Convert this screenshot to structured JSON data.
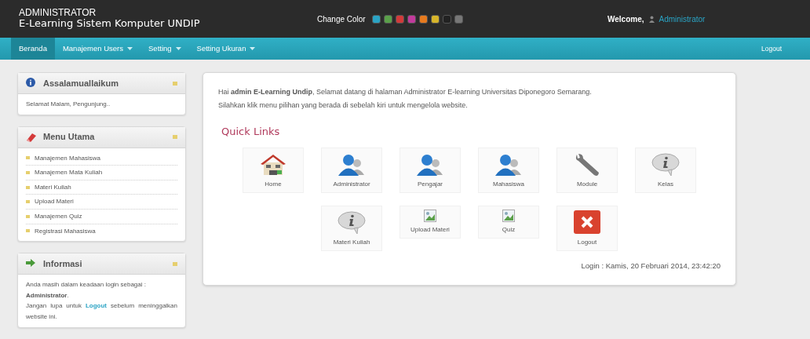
{
  "header": {
    "role": "ADMINISTRATOR",
    "site_title": "E-Learning Sistem Komputer UNDIP",
    "change_color_label": "Change Color",
    "swatches": [
      {
        "color": "#2aa3c4",
        "selected": false
      },
      {
        "color": "#5aa04a",
        "selected": false
      },
      {
        "color": "#d23a3a",
        "selected": false
      },
      {
        "color": "#c23a9c",
        "selected": false
      },
      {
        "color": "#e77a1e",
        "selected": false
      },
      {
        "color": "#d7b52a",
        "selected": false
      },
      {
        "color": "#222222",
        "selected": false
      },
      {
        "color": "#777777",
        "selected": false
      }
    ],
    "welcome": "Welcome,",
    "user": "Administrator"
  },
  "nav": {
    "items": [
      {
        "label": "Beranda",
        "dropdown": false,
        "selected": true
      },
      {
        "label": "Manajemen Users",
        "dropdown": true,
        "selected": false
      },
      {
        "label": "Setting",
        "dropdown": true,
        "selected": false
      },
      {
        "label": "Setting Ukuran",
        "dropdown": true,
        "selected": false
      }
    ],
    "logout": "Logout"
  },
  "sidebar": {
    "panels": [
      {
        "title": "Assalamuallaikum",
        "kind": "text",
        "text": "Selamat Malam, Pengunjung.."
      },
      {
        "title": "Menu Utama",
        "kind": "menu",
        "items": [
          "Manajemen Mahasiswa",
          "Manajemen Mata Kuliah",
          "Materi Kuliah",
          "Upload Materi",
          "Manajemen Quiz",
          "Registrasi Mahasiswa"
        ]
      },
      {
        "title": "Informasi",
        "kind": "info",
        "line1": "Anda masih dalam keadaan login sebagai : **Administrator**.",
        "before_link": "Jangan lupa untuk",
        "link": "Logout",
        "after_link": "sebelum meninggalkan website ini."
      }
    ]
  },
  "main": {
    "intro": [
      "Hai **admin E-Learning Undip**, Selamat datang di halaman Administrator E-learning Universitas Diponegoro Semarang.",
      "Silahkan klik menu pilihan yang berada di sebelah kiri untuk mengelola website."
    ],
    "quick_links_title": "Quick Links",
    "quick_links": [
      {
        "label": "Home",
        "kind": "home"
      },
      {
        "label": "Administrator",
        "kind": "user"
      },
      {
        "label": "Pengajar",
        "kind": "user"
      },
      {
        "label": "Mahasiswa",
        "kind": "user"
      },
      {
        "label": "Module",
        "kind": "wrench"
      },
      {
        "label": "Kelas",
        "kind": "info"
      },
      {
        "label": "Materi Kuliah",
        "kind": "info"
      },
      {
        "label": "Upload Materi",
        "kind": "broken"
      },
      {
        "label": "Quiz",
        "kind": "broken"
      },
      {
        "label": "Logout",
        "kind": "logout"
      }
    ],
    "login_info": "Login : Kamis, 20 Februari 2014, 23:42:20"
  }
}
